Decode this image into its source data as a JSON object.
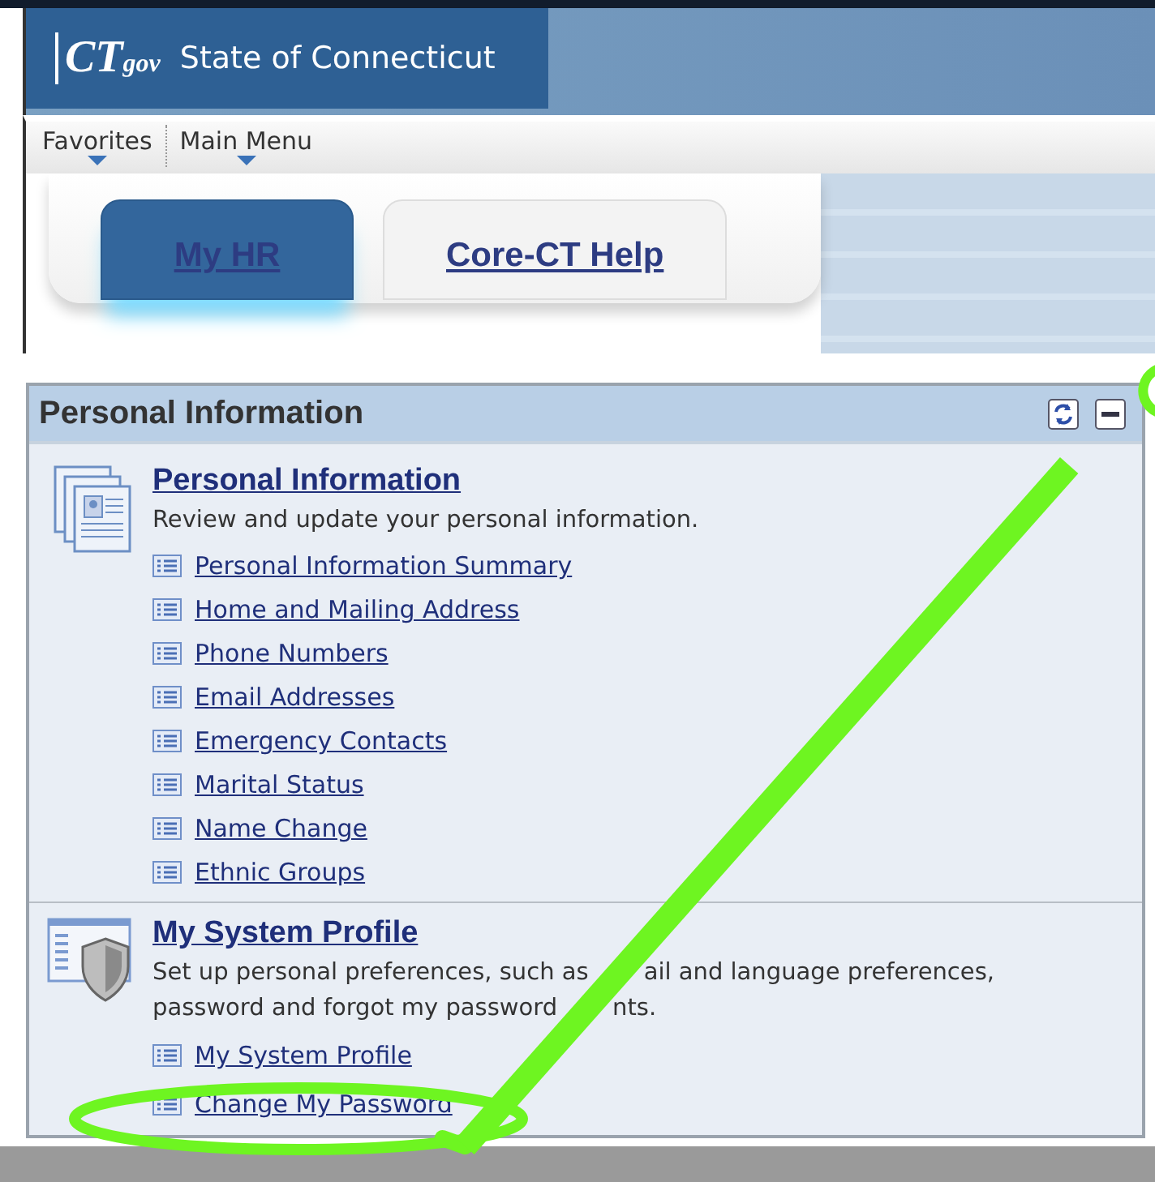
{
  "header": {
    "logo_mark": "CT",
    "logo_suffix": "gov",
    "site_title": "State of Connecticut"
  },
  "menu": [
    {
      "label": "Favorites"
    },
    {
      "label": "Main Menu"
    }
  ],
  "tabs": [
    {
      "label": "My HR",
      "selected": true
    },
    {
      "label": "Core-CT Help",
      "selected": false
    }
  ],
  "pagelet": {
    "title": "Personal Information",
    "sections": [
      {
        "kind": "personal",
        "title": "Personal Information",
        "description_lines": [
          [
            "Review and update your personal information."
          ]
        ],
        "links": [
          "Personal Information Summary",
          "Home and Mailing Address",
          "Phone Numbers",
          "Email Addresses",
          "Emergency Contacts",
          "Marital Status",
          "Name Change",
          "Ethnic Groups"
        ]
      },
      {
        "kind": "profile",
        "title": "My System Profile",
        "description_lines": [
          [
            "Set up personal preferences, such as",
            "ail and language preferences,"
          ],
          [
            "password and forgot my password",
            "nts."
          ]
        ],
        "links": [
          "My System Profile",
          "Change My Password"
        ]
      }
    ]
  }
}
